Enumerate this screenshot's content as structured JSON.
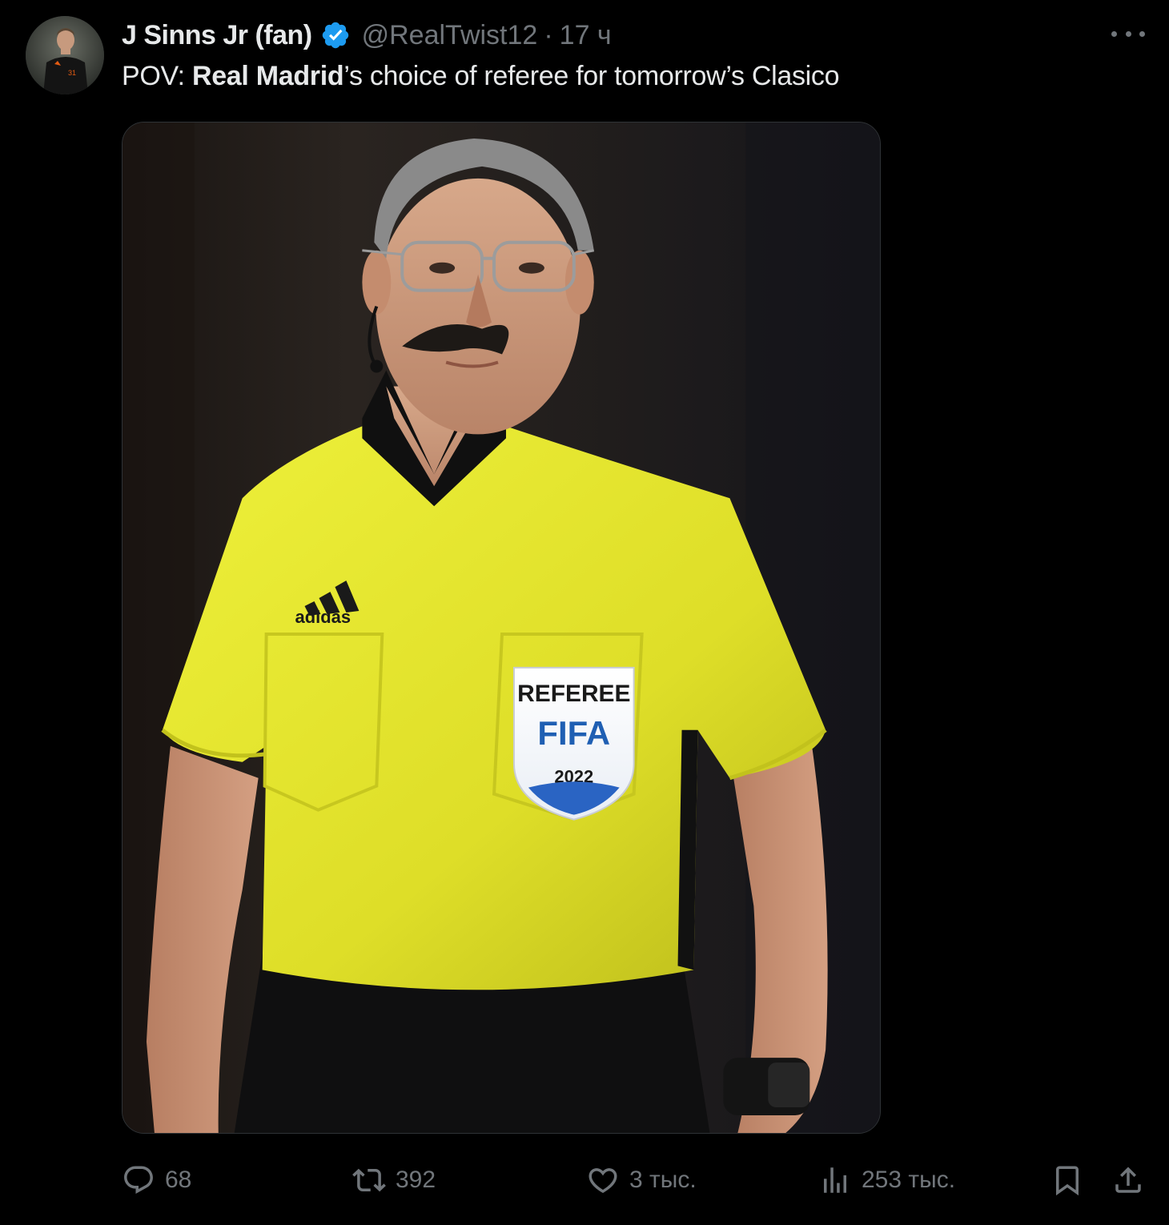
{
  "author": {
    "display_name": "J Sinns Jr (fan)",
    "handle": "@RealTwist12",
    "separator": "·",
    "time": "17 ч",
    "verified": true,
    "verified_color": "#1d9bf0"
  },
  "tweet": {
    "prefix": "POV: ",
    "bold": "Real Madrid",
    "suffix": "’s choice of referee for tomorrow’s Clasico"
  },
  "media": {
    "badge_line1": "REFEREE",
    "badge_line2": "FIFA",
    "badge_line3": "2022",
    "shirt_brand": "adidas",
    "shirt_color": "#e3e32c"
  },
  "actions": {
    "replies": "68",
    "reposts": "392",
    "likes": "3 тыс.",
    "views": "253 тыс."
  },
  "colors": {
    "background": "#000000",
    "text_primary": "#e7e9ea",
    "text_secondary": "#71767b",
    "border": "#2f3336"
  }
}
